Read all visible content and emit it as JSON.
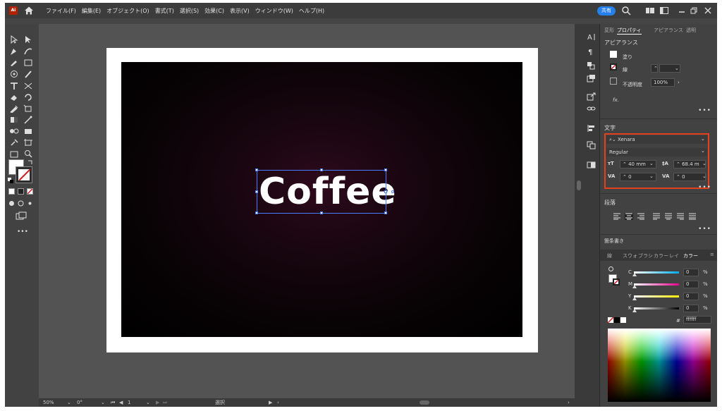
{
  "app": {
    "logo": "Ai",
    "share_label": "共有"
  },
  "menu": [
    "ファイル(F)",
    "編集(E)",
    "オブジェクト(O)",
    "書式(T)",
    "選択(S)",
    "効果(C)",
    "表示(V)",
    "ウィンドウ(W)",
    "ヘルプ(H)"
  ],
  "canvas": {
    "text": "Coffee"
  },
  "status": {
    "zoom": "50%",
    "rotation": "0°",
    "artboard": "1",
    "tool": "選択"
  },
  "panel": {
    "tabs": [
      "変形",
      "プロパティ",
      "アピアランス",
      "透明"
    ],
    "appearance": {
      "title": "アピアランス",
      "fill_label": "塗り",
      "stroke_label": "線",
      "opacity_label": "不透明度",
      "opacity_value": "100%",
      "fx_label": "fx."
    },
    "character": {
      "title": "文字",
      "font_family": "Xenara",
      "font_style": "Regular",
      "font_size": "40 mm",
      "leading": "68.4 m",
      "kerning": "0",
      "tracking": "0"
    },
    "paragraph": {
      "title": "段落"
    },
    "bullets": {
      "title": "箇条書き"
    },
    "color_tabs": [
      "線",
      "スウォ",
      "ブラシ",
      "カラー",
      "レイ",
      "カラー"
    ],
    "color": {
      "c_label": "C",
      "c_value": "0",
      "m_label": "M",
      "m_value": "0",
      "y_label": "Y",
      "y_value": "0",
      "k_label": "K",
      "k_value": "0",
      "percent": "%",
      "hex_label": "#",
      "hex_value": "ffffff"
    }
  },
  "colors": {
    "accent": "#2680eb",
    "highlight": "#e5401c",
    "stroke_red": "#d4191c"
  }
}
